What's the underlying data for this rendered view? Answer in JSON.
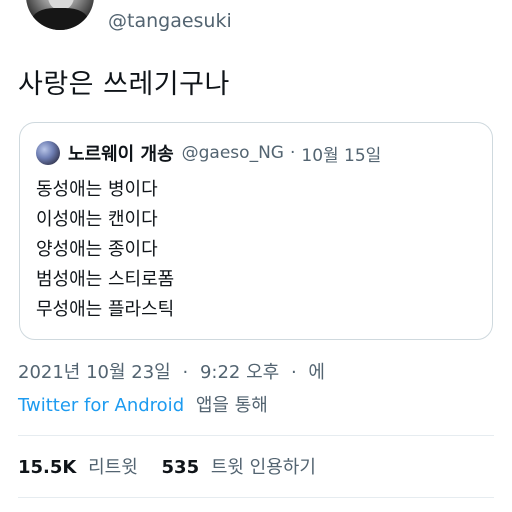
{
  "tweet": {
    "handle": "@tangaesuki",
    "text": "사랑은 쓰레기구나"
  },
  "quoted_tweet": {
    "name": "노르웨이 개송",
    "handle": "@gaeso_NG",
    "separator": "·",
    "date": "10월 15일",
    "lines": [
      "동성애는 병이다",
      "이성애는 캔이다",
      "양성애는 종이다",
      "범성애는 스티로폼",
      "무성애는 플라스틱"
    ]
  },
  "meta": {
    "date": "2021년 10월 23일",
    "sep1": "·",
    "time": "9:22 오후",
    "sep2": "·",
    "trail": "에",
    "source": "Twitter for Android",
    "source_suffix": "앱을 통해"
  },
  "stats": {
    "retweets_count": "15.5K",
    "retweets_label": "리트윗",
    "quotes_count": "535",
    "quotes_label": "트윗 인용하기"
  },
  "colors": {
    "text_primary": "#0f1419",
    "text_secondary": "#536471",
    "link": "#1d9bf0",
    "border": "#cfd9de"
  }
}
